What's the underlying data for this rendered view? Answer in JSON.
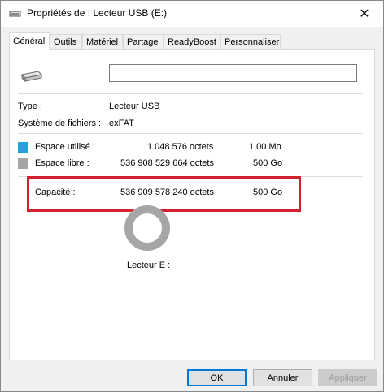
{
  "window": {
    "title": "Propriétés de : Lecteur USB (E:)",
    "close_glyph": "✕"
  },
  "tabs": [
    {
      "label": "Général"
    },
    {
      "label": "Outils"
    },
    {
      "label": "Matériel"
    },
    {
      "label": "Partage"
    },
    {
      "label": "ReadyBoost"
    },
    {
      "label": "Personnaliser"
    }
  ],
  "general": {
    "name_value": "",
    "type_label": "Type :",
    "type_value": "Lecteur USB",
    "fs_label": "Système de fichiers :",
    "fs_value": "exFAT",
    "used": {
      "label": "Espace utilisé :",
      "bytes": "1 048 576 octets",
      "size": "1,00 Mo",
      "color": "#26a0da"
    },
    "free": {
      "label": "Espace libre :",
      "bytes": "536 908 529 664 octets",
      "size": "500 Go",
      "color": "#a6a6a6"
    },
    "capacity": {
      "label": "Capacité :",
      "bytes": "536 909 578 240 octets",
      "size": "500 Go"
    },
    "drive_label": "Lecteur E :",
    "used_fraction": 2e-06
  },
  "buttons": {
    "ok": "OK",
    "cancel": "Annuler",
    "apply": "Appliquer"
  },
  "colors": {
    "highlight": "#d2232f",
    "accent": "#0078d7"
  }
}
